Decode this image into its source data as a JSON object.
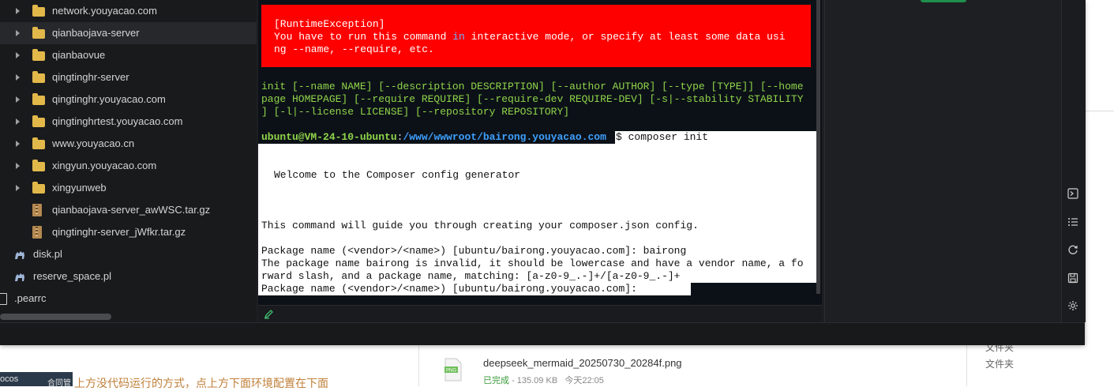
{
  "sidebar": {
    "items": [
      {
        "label": "network.youyacao.com",
        "type": "folder"
      },
      {
        "label": "qianbaojava-server",
        "type": "folder"
      },
      {
        "label": "qianbaovue",
        "type": "folder"
      },
      {
        "label": "qingtinghr-server",
        "type": "folder"
      },
      {
        "label": "qingtinghr.youyacao.com",
        "type": "folder"
      },
      {
        "label": "qingtinghrtest.youyacao.com",
        "type": "folder"
      },
      {
        "label": "www.youyacao.cn",
        "type": "folder"
      },
      {
        "label": "xingyun.youyacao.com",
        "type": "folder"
      },
      {
        "label": "xingyunweb",
        "type": "folder"
      },
      {
        "label": "qianbaojava-server_awWSC.tar.gz",
        "type": "archive"
      },
      {
        "label": "qingtinghr-server_jWfkr.tar.gz",
        "type": "archive"
      },
      {
        "label": "disk.pl",
        "type": "perl"
      },
      {
        "label": "reserve_space.pl",
        "type": "perl"
      },
      {
        "label": ".pearrc",
        "type": "file"
      }
    ]
  },
  "terminal": {
    "error_title": "[RuntimeException]",
    "error_line1_a": "You have to run this command ",
    "error_line1_hl": "in",
    "error_line1_b": " interactive mode, or specify at least some data usi",
    "error_line2": "ng --name, --require, etc.",
    "usage_line1": "init [--name NAME] [--description DESCRIPTION] [--author AUTHOR] [--type [TYPE]] [--home",
    "usage_line2": "page HOMEPAGE] [--require REQUIRE] [--require-dev REQUIRE-DEV] [-s|--stability STABILITY",
    "usage_line3": "] [-l|--license LICENSE] [--repository REPOSITORY]",
    "prompt_user": "ubuntu@VM-24-10-ubuntu",
    "prompt_colon": ":",
    "prompt_path": "/www/wwwroot/bairong.youyacao.com",
    "command": "$ composer init",
    "welcome": "Welcome to the Composer config generator",
    "guide": "This command will guide you through creating your composer.json config.",
    "pkg_prompt1": "Package name (<vendor>/<name>) [ubuntu/bairong.youyacao.com]: bairong",
    "invalid_line1": "The package name bairong is invalid, it should be lowercase and have a vendor name, a fo",
    "invalid_line2": "rward slash, and a package name, matching: [a-z0-9_.-]+/[a-z0-9_.-]+",
    "pkg_prompt2": "Package name (<vendor>/<name>) [ubuntu/bairong.youyacao.com]:"
  },
  "download": {
    "file_name": "deepseek_mermaid_20250730_20284f.png",
    "icon_text": "PNG",
    "status": "已完成",
    "size": " - 135.09 KB",
    "time": "今天22:05",
    "folder_a": "文件夹",
    "folder_b": "文件夹"
  },
  "background": {
    "thumb_text1": "ocos",
    "thumb_text2": "合同管",
    "partial_text": "上方没代码运行的方式，点上方下面环境配置在下面"
  },
  "colors": {
    "error_bg": "#ff0000",
    "prompt_green": "#8fd44a",
    "prompt_blue": "#3ea0ff"
  }
}
